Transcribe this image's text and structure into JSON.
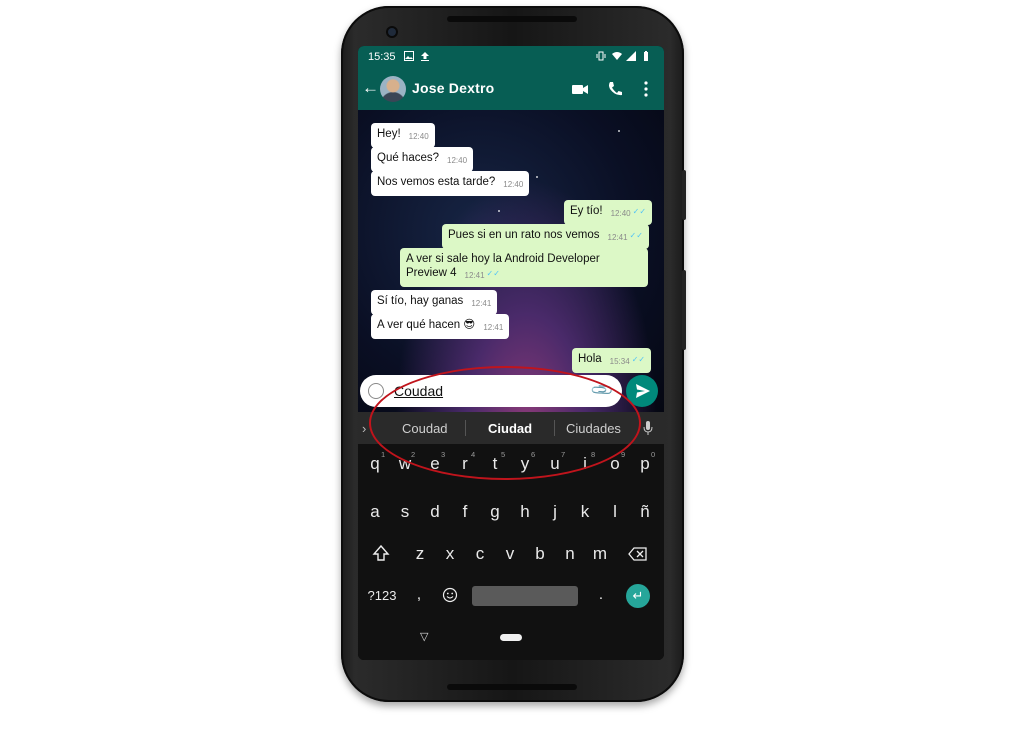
{
  "status_bar": {
    "time": "15:35",
    "icons": [
      "image-icon",
      "upload-icon",
      "vibrate-icon",
      "wifi-icon",
      "battery-icon"
    ]
  },
  "app_bar": {
    "contact_name": "Jose Dextro",
    "icons": [
      "back-arrow-icon",
      "video-call-icon",
      "phone-icon",
      "more-vert-icon"
    ]
  },
  "messages": [
    {
      "text": "Hey!",
      "time": "12:40",
      "dir": "in"
    },
    {
      "text": "Qué haces?",
      "time": "12:40",
      "dir": "in"
    },
    {
      "text": "Nos vemos esta tarde?",
      "time": "12:40",
      "dir": "in"
    },
    {
      "text": "Ey tío!",
      "time": "12:40",
      "dir": "out"
    },
    {
      "text": "Pues si en un rato nos vemos",
      "time": "12:41",
      "dir": "out"
    },
    {
      "text": "A ver si sale hoy la Android Developer Preview 4",
      "time": "12:41",
      "dir": "out"
    },
    {
      "text": "Sí tío, hay ganas",
      "time": "12:41",
      "dir": "in"
    },
    {
      "text": "A ver qué hacen 😎",
      "time": "12:41",
      "dir": "in"
    },
    {
      "text": "Hola",
      "time": "15:34",
      "dir": "out"
    }
  ],
  "composer": {
    "input_value": "Coudad"
  },
  "suggestions": [
    "Coudad",
    "Ciudad",
    "Ciudades"
  ],
  "keyboard": {
    "row1": [
      "q",
      "w",
      "e",
      "r",
      "t",
      "y",
      "u",
      "i",
      "o",
      "p"
    ],
    "row1_hints": [
      "1",
      "2",
      "3",
      "4",
      "5",
      "6",
      "7",
      "8",
      "9",
      "0"
    ],
    "row2": [
      "a",
      "s",
      "d",
      "f",
      "g",
      "h",
      "j",
      "k",
      "l",
      "ñ"
    ],
    "row3": [
      "z",
      "x",
      "c",
      "v",
      "b",
      "n",
      "m"
    ],
    "symbols_key": "?123",
    "comma_key": ",",
    "period_key": "."
  },
  "colors": {
    "header": "#075e54",
    "outgoing_bubble": "#dcf8c6",
    "send_button": "#00897b",
    "highlight_oval": "#c0141c"
  }
}
